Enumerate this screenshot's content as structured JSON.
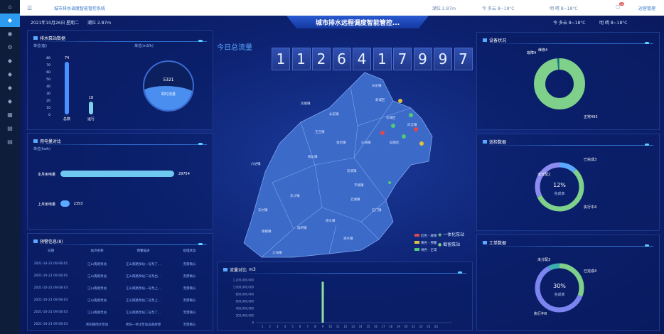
{
  "sidebar": {
    "items": [
      "home-icon",
      "water-icon",
      "eye-icon",
      "gear-icon",
      "diamond-icon",
      "diamond-icon",
      "diamond-icon",
      "diamond-icon",
      "grid-icon",
      "doc-icon",
      "doc-icon"
    ],
    "glyphs": [
      "⌂",
      "◆",
      "◉",
      "⚙",
      "◆",
      "◆",
      "◆",
      "◆",
      "▦",
      "▤",
      "▤"
    ],
    "active": 1
  },
  "topbar": {
    "menu_icon": "☰",
    "breadcrumb": "城市排水调度智能管控系统",
    "tide": "潮位 2.87m",
    "today_weather": "今 多云 8~18°C",
    "tomorrow_weather": "明 晴 8~18°C",
    "notif_count": "10",
    "user": "运营管理"
  },
  "header": {
    "date": "2021年10月26日",
    "weekday": "星期二",
    "tide": "潮位 2.87m",
    "title": "城市排水远程调度智能管控...",
    "weather_today": "今 多云 8~18°C",
    "weather_tomorrow": "明 晴 8~18°C"
  },
  "pump": {
    "title": "排水泵站数据",
    "unit_left": "单位(座)",
    "unit_right": "单位(m3/h)",
    "yticks": [
      0,
      10,
      20,
      30,
      40,
      50,
      60,
      70,
      80
    ],
    "bars": [
      {
        "label": "总数",
        "value": 74,
        "color": "#4a90ff"
      },
      {
        "label": "运行",
        "value": 18,
        "color": "#7fd0e8"
      }
    ],
    "flow_value": "5321",
    "flow_label": "瞬时流量"
  },
  "power": {
    "title": "用电量对比",
    "unit": "单位(kwh)",
    "rows": [
      {
        "label": "本月用电量",
        "value": 29754
      },
      {
        "label": "上月用电量",
        "value": 2353
      }
    ]
  },
  "alerts": {
    "title": "预警信息(8)",
    "headers": [
      "日期",
      "站点名称",
      "预警描述",
      "处理状态"
    ],
    "rows": [
      [
        "2021-10-21 09:08:01",
        "江山南路泵站",
        "江山南路泵站一号泵了...",
        "无需确认"
      ],
      [
        "2021-10-21 09:08:01",
        "江山南路泵站",
        "江山南路泵站二号泵出...",
        "无需确认"
      ],
      [
        "2021-10-21 09:08:03",
        "江山南路泵站",
        "江山南路泵站一号泵上...",
        "无需确认"
      ],
      [
        "2021-10-21 09:08:03",
        "江山南路泵站",
        "江山南路泵站二号泵上...",
        "无需确认"
      ],
      [
        "2021-10-21 09:08:03",
        "江山南路泵站",
        "江山南路泵站二号泵了...",
        "无需确认"
      ],
      [
        "2021-10-21 09:08:03",
        "青阳路雨水泵站",
        "青阳一体化泵站设备故障",
        "无需确认"
      ]
    ]
  },
  "total_flow": {
    "label": "今日总流量",
    "digits": [
      "1",
      "1",
      "2",
      "6",
      "4",
      "1",
      "7",
      "9",
      "9",
      "7"
    ]
  },
  "map": {
    "legend": [
      {
        "label": "红色 - 故障",
        "color": "#e04848"
      },
      {
        "label": "黄色 - 预警",
        "color": "#e0c040"
      },
      {
        "label": "绿色 - 正常",
        "color": "#50c878"
      }
    ],
    "station_types": [
      "一体化泵站",
      "截留泵站"
    ],
    "districts": [
      "六坊镇",
      "东沙镇",
      "东村镇",
      "梧桐镇",
      "高桥镇",
      "王庄镇",
      "大洲镇",
      "永安镇",
      "铜山镇",
      "双溪镇",
      "云湖镇",
      "桥头镇",
      "沙洲镇",
      "凤凰镇",
      "金鸡镇",
      "平湖镇",
      "石门镇",
      "新城区",
      "东湖区",
      "城南区",
      "白云镇",
      "长乐镇",
      "清水镇"
    ]
  },
  "chart_data": [
    {
      "type": "bar",
      "title": "流量对比",
      "ylabel": "m3",
      "categories": [
        "1",
        "2",
        "3",
        "4",
        "5",
        "6",
        "7",
        "8",
        "9",
        "10",
        "11",
        "12",
        "13",
        "14",
        "15",
        "16",
        "17",
        "18",
        "19",
        "20",
        "21",
        "22",
        "23",
        "24"
      ],
      "values": [
        0,
        0,
        0,
        0,
        0,
        0,
        0,
        0,
        1150000000,
        0,
        0,
        0,
        0,
        0,
        0,
        0,
        0,
        0,
        0,
        0,
        0,
        0,
        0,
        0
      ],
      "yticks": [
        "0",
        "200,000,000",
        "400,000,000",
        "600,000,000",
        "800,000,000",
        "1,000,000,000",
        "1,200,000,000"
      ],
      "ylim": [
        0,
        1200000000
      ]
    },
    {
      "type": "pie",
      "title": "设备状况",
      "slices": [
        {
          "label": "正常493",
          "value": 493,
          "color": "#7ed08a"
        },
        {
          "label": "故障4",
          "value": 4,
          "color": "#1f6f7a"
        },
        {
          "label": "维修4",
          "value": 4,
          "color": "#2a9a8a"
        }
      ]
    },
    {
      "type": "pie",
      "title": "巡检数据",
      "center_value": "12%",
      "center_label": "完成率",
      "slices": [
        {
          "label": "已完成3",
          "value": 3,
          "color": "#5aa8ff"
        },
        {
          "label": "执行中4",
          "value": 14,
          "color": "#7ed08a"
        },
        {
          "label": "未分配2",
          "value": 8,
          "color": "#8c8cf0"
        }
      ]
    },
    {
      "type": "pie",
      "title": "工单数据",
      "center_value": "30%",
      "center_label": "完成率",
      "slices": [
        {
          "label": "已完成4",
          "value": 4,
          "color": "#7ed08a"
        },
        {
          "label": "执行中8",
          "value": 8,
          "color": "#7c84f0"
        },
        {
          "label": "未分配3",
          "value": 1,
          "color": "#3ab0b0"
        }
      ]
    }
  ]
}
